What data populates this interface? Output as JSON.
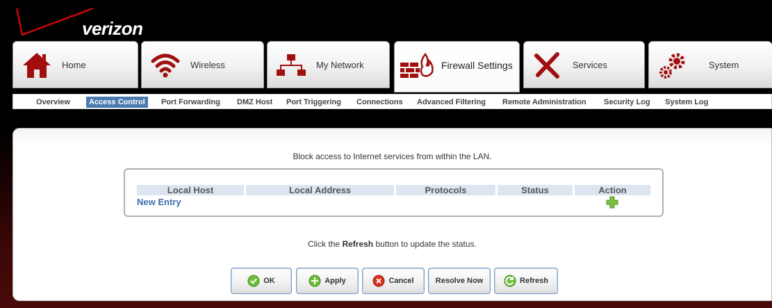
{
  "brand": {
    "logo_text": "verizon"
  },
  "tabs": [
    {
      "label": "Home",
      "icon": "home-icon"
    },
    {
      "label": "Wireless",
      "icon": "wifi-icon"
    },
    {
      "label": "My Network",
      "icon": "network-icon"
    },
    {
      "label": "Firewall Settings",
      "icon": "firewall-icon",
      "active": true
    },
    {
      "label": "Services",
      "icon": "tools-icon"
    },
    {
      "label": "System",
      "icon": "gears-icon"
    }
  ],
  "subnav": [
    {
      "label": "Overview"
    },
    {
      "label": "Access Control",
      "active": true
    },
    {
      "label": "Port Forwarding"
    },
    {
      "label": "DMZ Host"
    },
    {
      "label": "Port Triggering"
    },
    {
      "label": "Connections"
    },
    {
      "label": "Advanced Filtering"
    },
    {
      "label": "Remote Administration"
    },
    {
      "label": "Security Log"
    },
    {
      "label": "System Log"
    }
  ],
  "main": {
    "intro": "Block access to Internet services from within the LAN.",
    "table": {
      "headers": [
        "Local Host",
        "Local Address",
        "Protocols",
        "Status",
        "Action"
      ],
      "new_entry": "New Entry"
    },
    "hint_prefix": "Click the ",
    "hint_bold": "Refresh",
    "hint_suffix": " button to update the status."
  },
  "buttons": {
    "ok": "OK",
    "apply": "Apply",
    "cancel": "Cancel",
    "resolve": "Resolve Now",
    "refresh": "Refresh"
  },
  "colors": {
    "accent": "#4a7ab0",
    "brand_red": "#cd040b",
    "link": "#3a6fb0"
  }
}
